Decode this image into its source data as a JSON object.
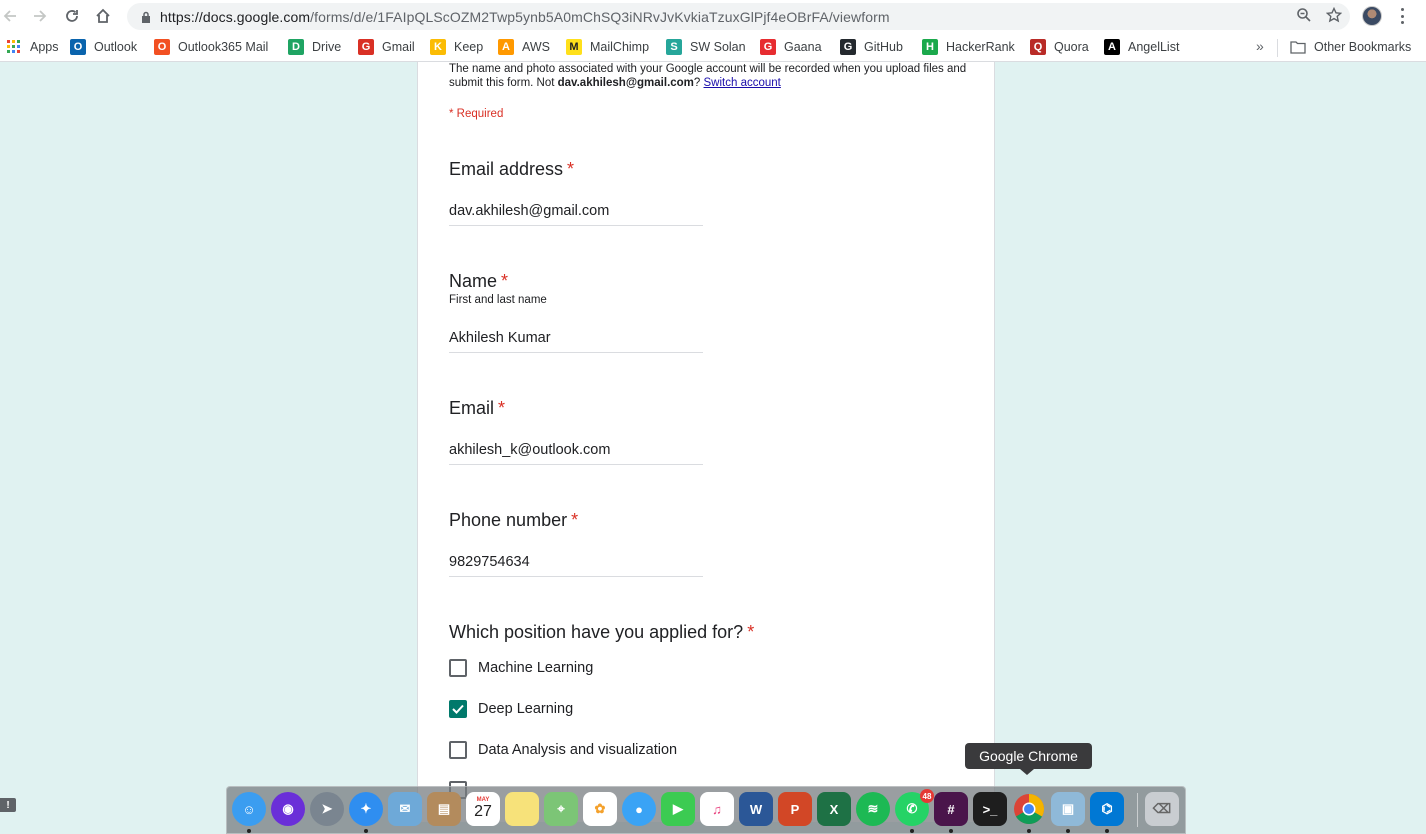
{
  "browser": {
    "url_host": "https://docs.google.com",
    "url_path": "/forms/d/e/1FAIpQLScOZM2Twp5ynb5A0mChSQ3iNRvJvKvkiaTzuxGlPjf4eOBrFA/viewform"
  },
  "bookmarks": {
    "items": [
      {
        "label": "Apps",
        "icon": "apps-grid-icon",
        "color": "#4285f4"
      },
      {
        "label": "Outlook",
        "icon": "outlook-icon",
        "color": "#0a64ad"
      },
      {
        "label": "Outlook365 Mail",
        "icon": "office365-icon",
        "color": "#f25022"
      },
      {
        "label": "Drive",
        "icon": "drive-icon",
        "color": "#1fa463"
      },
      {
        "label": "Gmail",
        "icon": "gmail-icon",
        "color": "#d93025"
      },
      {
        "label": "Keep",
        "icon": "keep-icon",
        "color": "#fbbc04"
      },
      {
        "label": "AWS",
        "icon": "aws-icon",
        "color": "#ff9900"
      },
      {
        "label": "MailChimp",
        "icon": "mailchimp-icon",
        "color": "#ffe01b"
      },
      {
        "label": "SW Solan",
        "icon": "sw-solan-icon",
        "color": "#26a69a"
      },
      {
        "label": "Gaana",
        "icon": "gaana-icon",
        "color": "#e72c30"
      },
      {
        "label": "GitHub",
        "icon": "github-icon",
        "color": "#24292e"
      },
      {
        "label": "HackerRank",
        "icon": "hackerrank-icon",
        "color": "#1ba94c"
      },
      {
        "label": "Quora",
        "icon": "quora-icon",
        "color": "#b92b27"
      },
      {
        "label": "AngelList",
        "icon": "angellist-icon",
        "color": "#000000"
      }
    ],
    "more": "»",
    "other": "Other Bookmarks"
  },
  "form": {
    "notice_pre": "The name and photo associated with your Google account will be recorded when you upload files and submit this form. Not ",
    "notice_email": "dav.akhilesh@gmail.com",
    "notice_mid": "? ",
    "switch_account": "Switch account",
    "required_note": "* Required",
    "required_star": "*",
    "questions": {
      "email_address": {
        "title": "Email address",
        "value": "dav.akhilesh@gmail.com"
      },
      "name": {
        "title": "Name",
        "help": "First and last name",
        "value": "Akhilesh Kumar"
      },
      "email": {
        "title": "Email",
        "value": "akhilesh_k@outlook.com"
      },
      "phone": {
        "title": "Phone number",
        "value": "9829754634"
      },
      "position": {
        "title": "Which position have you applied for?",
        "options": [
          {
            "label": "Machine Learning",
            "checked": false
          },
          {
            "label": "Deep Learning",
            "checked": true
          },
          {
            "label": "Data Analysis and visualization",
            "checked": false
          }
        ]
      }
    },
    "accent_color": "#00796b",
    "required_color": "#d93025",
    "background_color": "#e0f2f1"
  },
  "tooltip": {
    "text": "Google Chrome"
  },
  "dock": {
    "whatsapp_badge": "48",
    "calendar_month": "MAY",
    "calendar_day": "27",
    "items": [
      "finder-icon",
      "siri-icon",
      "launchpad-icon",
      "safari-icon",
      "mail-icon",
      "contacts-icon",
      "calendar-icon",
      "notes-icon",
      "maps-icon",
      "photos-icon",
      "messages-icon",
      "facetime-icon",
      "itunes-icon",
      "word-icon",
      "powerpoint-icon",
      "excel-icon",
      "spotify-icon",
      "whatsapp-icon",
      "slack-icon",
      "terminal-icon",
      "chrome-icon",
      "preview-icon",
      "vscode-icon",
      "trash-icon"
    ]
  }
}
